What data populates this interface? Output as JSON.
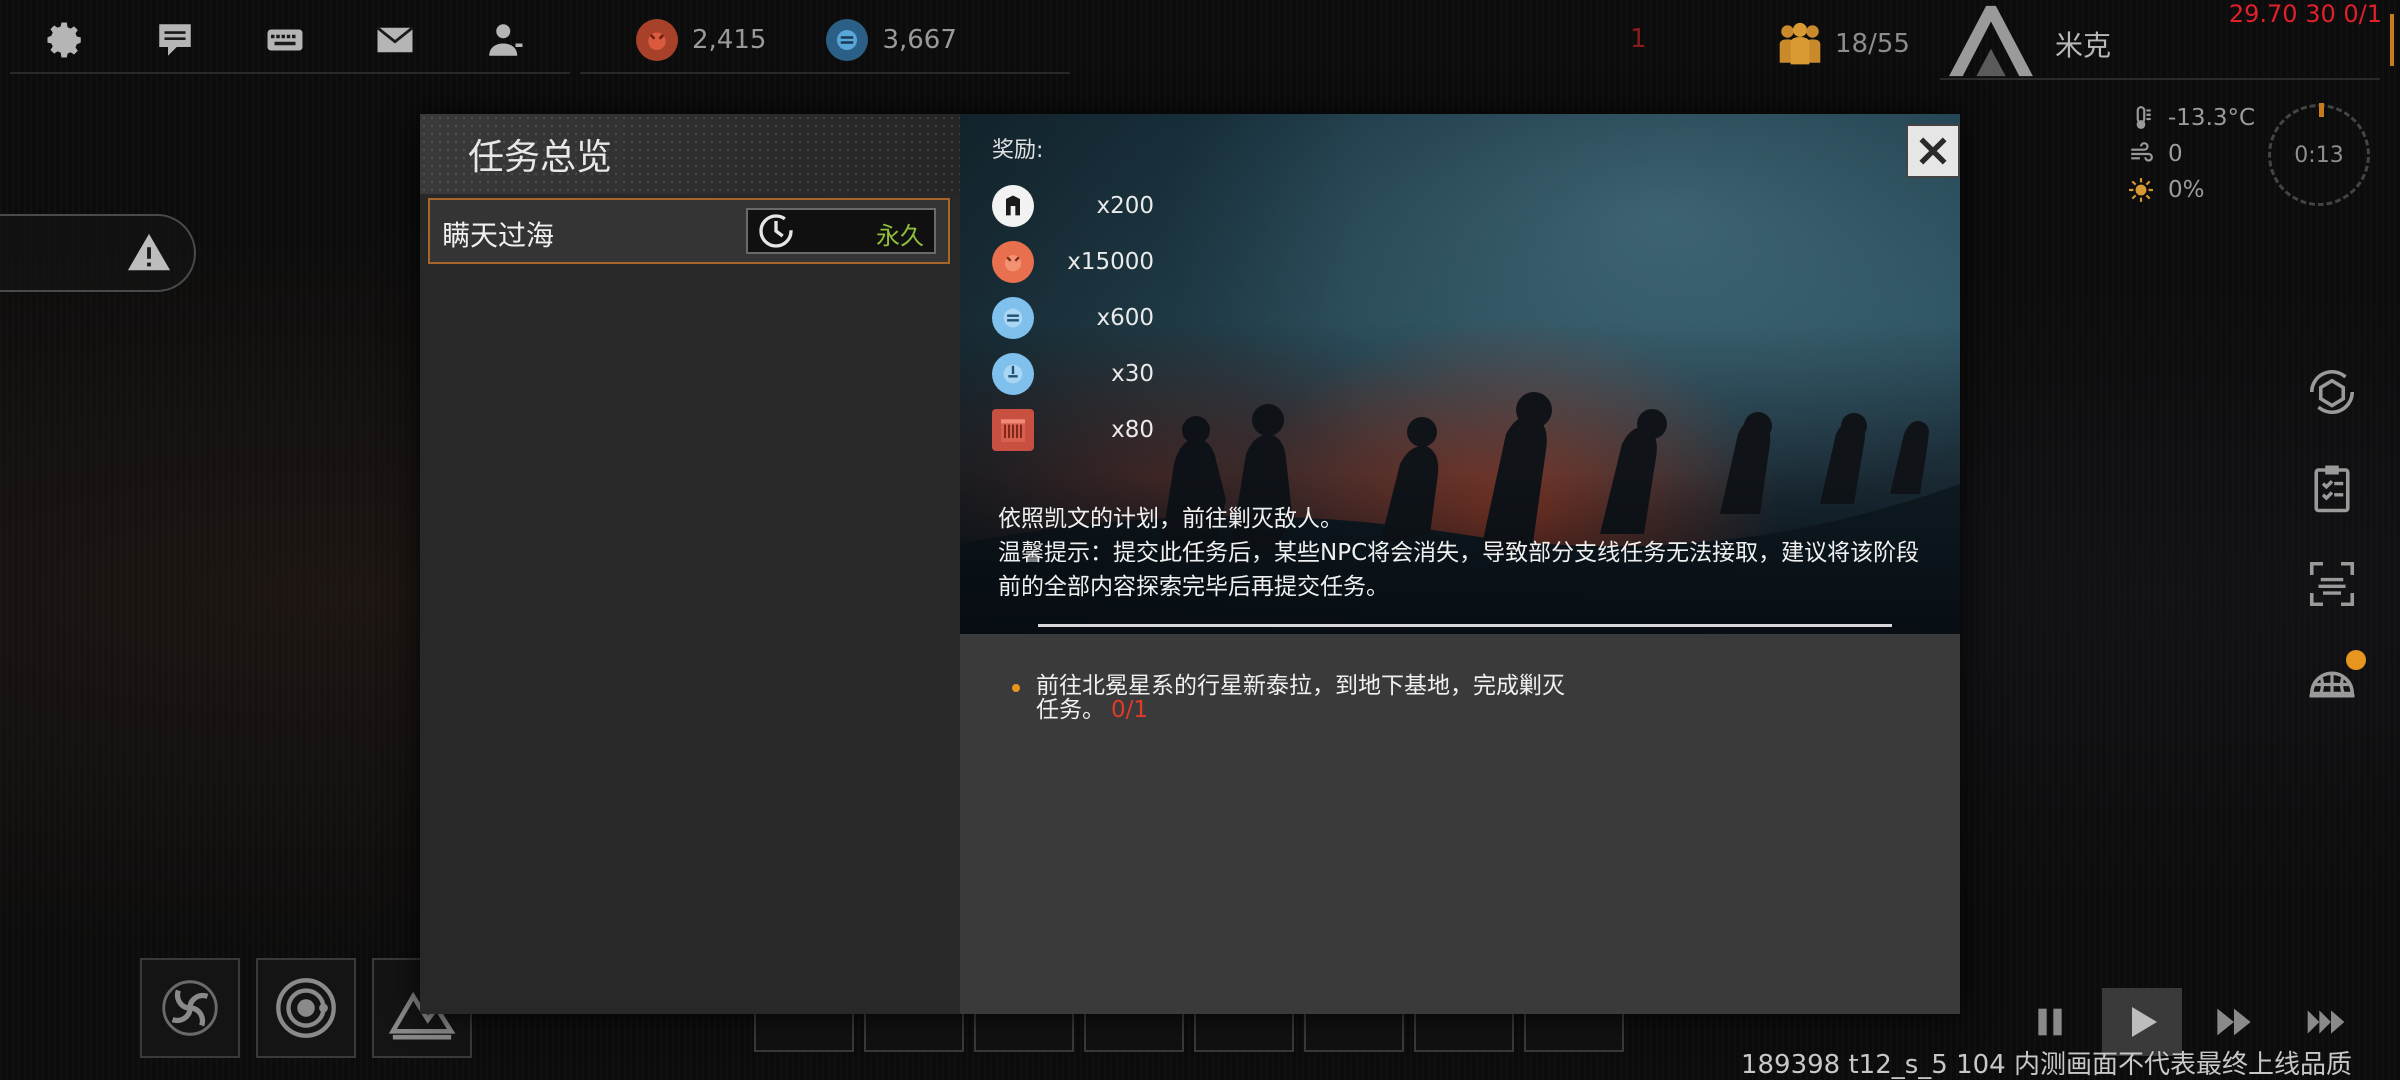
{
  "colors": {
    "accent_orange": "#e6951f",
    "progress_red": "#e23a2a",
    "permanent_green": "#8fbe3a",
    "debug_red": "#e0202a"
  },
  "topbar": {
    "icons": [
      "gear-icon",
      "chat-icon",
      "keyboard-icon",
      "mail-icon",
      "profile-icon"
    ],
    "resources": [
      {
        "icon": "red-resource-icon",
        "value": "2,415"
      },
      {
        "icon": "blue-resource-icon",
        "value": "3,667"
      }
    ],
    "alert_count": "1",
    "population": "18/55",
    "city_name": "米克",
    "debug": "29.70 30 0/1"
  },
  "weather": {
    "temperature": "-13.3°C",
    "wind": "0",
    "sun": "0%"
  },
  "clock": "0:13",
  "modal": {
    "title": "任务总览",
    "quest": {
      "name": "瞒天过海",
      "duration_label": "永久"
    },
    "reward_label": "奖励:",
    "rewards": [
      {
        "icon": "rank-icon",
        "qty": "x200"
      },
      {
        "icon": "red-resource-icon",
        "qty": "x15000"
      },
      {
        "icon": "blue-resource-icon",
        "qty": "x600"
      },
      {
        "icon": "blue-core-icon",
        "qty": "x30"
      },
      {
        "icon": "red-crate-icon",
        "qty": "x80"
      }
    ],
    "description_line1": "依照凯文的计划，前往剿灭敌人。",
    "description_line2": "温馨提示：提交此任务后，某些NPC将会消失，导致部分支线任务无法接取，建议将该阶段前的全部内容探索完毕后再提交任务。",
    "objective_text": "前往北冕星系的行星新泰拉，到地下基地，完成剿灭任务。",
    "objective_progress": "0/1"
  },
  "footer_debug": "189398 t12_s_5 104 内测画面不代表最终上线品质"
}
